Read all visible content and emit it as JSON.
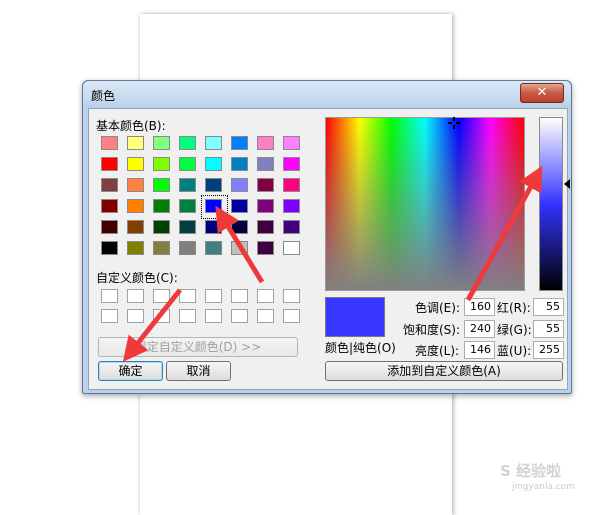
{
  "dialog": {
    "title": "颜色",
    "close_icon": "close-icon",
    "basic_colors_label": "基本颜色(B):",
    "basic_colors": [
      [
        "#ff8080",
        "#ffff80",
        "#80ff80",
        "#00ff80",
        "#80ffff",
        "#0080ff",
        "#ff80c0",
        "#ff80ff"
      ],
      [
        "#ff0000",
        "#ffff00",
        "#80ff00",
        "#00ff40",
        "#00ffff",
        "#0080c0",
        "#8080c0",
        "#ff00ff"
      ],
      [
        "#804040",
        "#ff8040",
        "#00ff00",
        "#008080",
        "#004080",
        "#8080ff",
        "#800040",
        "#ff0080"
      ],
      [
        "#800000",
        "#ff8000",
        "#008000",
        "#008040",
        "#0000ff",
        "#0000a0",
        "#800080",
        "#8000ff"
      ],
      [
        "#400000",
        "#804000",
        "#004000",
        "#004040",
        "#000080",
        "#000040",
        "#400040",
        "#400080"
      ],
      [
        "#000000",
        "#808000",
        "#808040",
        "#808080",
        "#408080",
        "#c0c0c0",
        "#400040",
        "#ffffff"
      ]
    ],
    "custom_colors_label": "自定义颜色(C):",
    "define_custom_button": "规定自定义颜色(D) >>",
    "ok_button": "确定",
    "cancel_button": "取消",
    "color_solid_label": "颜色|纯色(O)",
    "hue_label": "色调(E):",
    "hue_value": "160",
    "sat_label": "饱和度(S):",
    "sat_value": "240",
    "lum_label": "亮度(L):",
    "lum_value": "146",
    "red_label": "红(R):",
    "red_value": "55",
    "green_label": "绿(G):",
    "green_value": "55",
    "blue_label": "蓝(U):",
    "blue_value": "255",
    "add_custom_button": "添加到自定义颜色(A)",
    "preview_color": "#3737ff",
    "selected_swatch": [
      3,
      4
    ]
  },
  "watermark": {
    "main": "S 经验啦",
    "sub": "jingyanla.com"
  },
  "arrow_color": "#ee3a3a"
}
